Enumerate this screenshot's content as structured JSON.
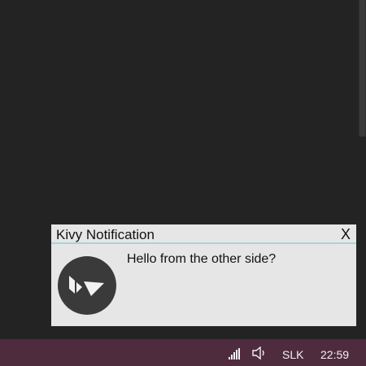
{
  "notification": {
    "title": "Kivy Notification",
    "close_label": "X",
    "message": "Hello from the other side?",
    "icon": "kivy-logo-icon",
    "divider_color": "#a9d2dc"
  },
  "taskbar": {
    "color": "#4f2b3e",
    "tray": {
      "network_icon": "signal-bars-icon",
      "volume_icon": "speaker-icon",
      "language": "SLK",
      "clock": "22:59"
    }
  }
}
